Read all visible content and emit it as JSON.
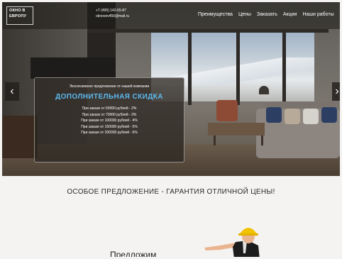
{
  "header": {
    "logo_line1": "ОКНО В",
    "logo_line2": "ЕВРОПУ",
    "phone": "+7 (495) 142-65-87",
    "email": "oknovev450@mail.ru",
    "nav": [
      "Преимущества",
      "Цены",
      "Заказать",
      "Акции",
      "Наши работы"
    ]
  },
  "slider": {
    "prev_icon": "chevron-left-icon",
    "next_icon": "chevron-right-icon",
    "prev_glyph": "‹",
    "next_glyph": "›"
  },
  "offer": {
    "subtitle": "Эксклюзивное предложение от нашей компании",
    "title": "ДОПОЛНИТЕЛЬНАЯ СКИДКА",
    "items": [
      "При заказе от 50000 рублей - 2%",
      "При заказе от 70000 рублей - 3%",
      "При заказе от 100000 рублей - 4%",
      "При заказе от 150000 рублей - 5%",
      "При заказе от 200000 рублей - 6%"
    ],
    "accent_color": "#5db9ef"
  },
  "special_heading": "ОСОБОЕ ПРЕДЛОЖЕНИЕ - ГАРАНТИЯ ОТЛИЧНОЙ ЦЕНЫ!",
  "predlozhim": "Предложим"
}
